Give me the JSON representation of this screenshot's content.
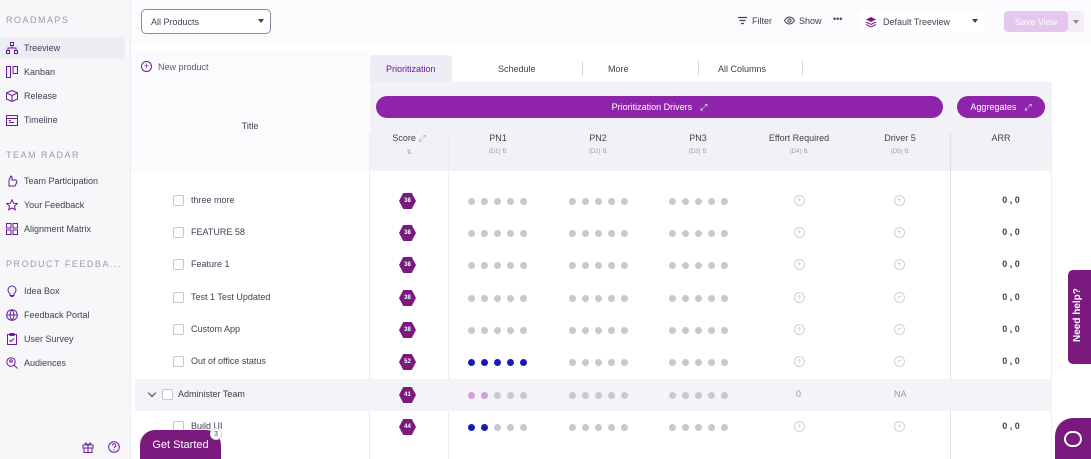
{
  "sidebar": {
    "sections": [
      {
        "title": "ROADMAPS",
        "items": [
          {
            "label": "Treeview",
            "icon": "tree-icon",
            "active": true
          },
          {
            "label": "Kanban",
            "icon": "kanban-icon"
          },
          {
            "label": "Release",
            "icon": "box-icon"
          },
          {
            "label": "Timeline",
            "icon": "calendar-icon"
          }
        ]
      },
      {
        "title": "TEAM RADAR",
        "items": [
          {
            "label": "Team Participation",
            "icon": "hand-icon"
          },
          {
            "label": "Your Feedback",
            "icon": "star-icon"
          },
          {
            "label": "Alignment Matrix",
            "icon": "grid-icon"
          }
        ]
      },
      {
        "title": "PRODUCT FEEDBA...",
        "items": [
          {
            "label": "Idea Box",
            "icon": "bulb-icon"
          },
          {
            "label": "Feedback Portal",
            "icon": "globe-icon"
          },
          {
            "label": "User Survey",
            "icon": "clipboard-icon"
          },
          {
            "label": "Audiences",
            "icon": "search-people-icon"
          }
        ]
      }
    ]
  },
  "topbar": {
    "product_select": "All Products",
    "filter_label": "Filter",
    "show_label": "Show",
    "more_label": "•••",
    "treeview_select": "Default Treeview",
    "save_view_label": "Save View"
  },
  "grid": {
    "new_product_label": "New product",
    "title_header": "Title",
    "tabs": [
      "Prioritization",
      "Schedule",
      "More",
      "All Columns"
    ],
    "drivers_label": "Prioritization Drivers",
    "aggregates_label": "Aggregates",
    "columns": [
      {
        "label": "Score",
        "sub": ""
      },
      {
        "label": "PN1",
        "sub": "(D1)"
      },
      {
        "label": "PN2",
        "sub": "(D2)"
      },
      {
        "label": "PN3",
        "sub": "(D3)"
      },
      {
        "label": "Effort Required",
        "sub": "(D4)"
      },
      {
        "label": "Driver 5",
        "sub": "(D5)"
      },
      {
        "label": "ARR",
        "sub": ""
      }
    ],
    "rows": [
      {
        "title": "three more",
        "score": "38",
        "pn1": 0,
        "pn2": 0,
        "pn3": 0,
        "arr": "0 , 0"
      },
      {
        "title": "FEATURE 58",
        "score": "38",
        "pn1": 0,
        "pn2": 0,
        "pn3": 0,
        "arr": "0 , 0"
      },
      {
        "title": "Feature 1",
        "score": "38",
        "pn1": 0,
        "pn2": 0,
        "pn3": 0,
        "arr": "0 , 0"
      },
      {
        "title": "Test 1 Test Updated",
        "score": "38",
        "pn1": 0,
        "pn2": 0,
        "pn3": 0,
        "arr": "0 , 0"
      },
      {
        "title": "Custom App",
        "score": "38",
        "pn1": 0,
        "pn2": 0,
        "pn3": 0,
        "arr": "0 , 0"
      },
      {
        "title": "Out of office status",
        "score": "52",
        "pn1": 5,
        "pn2": 0,
        "pn3": 0,
        "arr": "0 , 0"
      },
      {
        "title": "Administer Team",
        "score": "41",
        "group": true,
        "pn1_pink": 2,
        "effort": "0",
        "driver5": "NA",
        "arr": ""
      },
      {
        "title": "Build UI",
        "score": "44",
        "pn1": 2,
        "pn2": 0,
        "pn3": 0,
        "arr": "0 , 0"
      }
    ]
  },
  "floating": {
    "get_started_label": "Get Started",
    "get_started_badge": "3",
    "need_help_label": "Need help?"
  },
  "colors": {
    "brand": "#7a1a7e",
    "pill": "#8e24aa",
    "dot_active": "#1a1ab8",
    "dot_pink": "#d79be0"
  }
}
